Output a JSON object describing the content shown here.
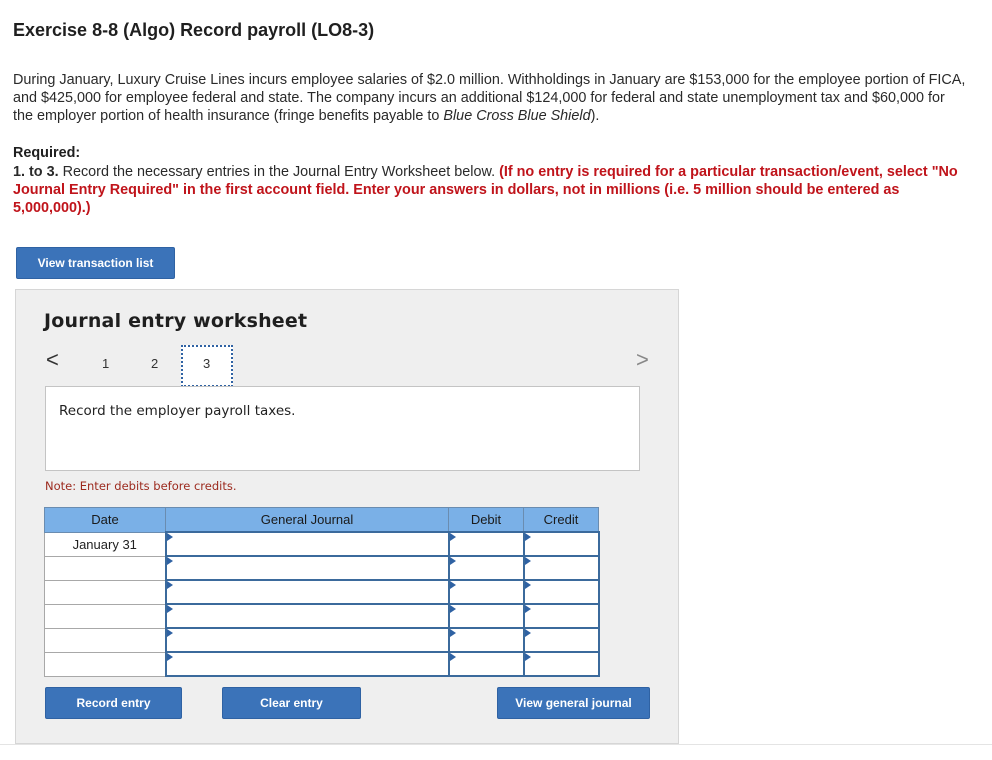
{
  "header": {
    "title": "Exercise 8-8 (Algo) Record payroll (LO8-3)"
  },
  "intro": {
    "text_before_italic": "During January, Luxury Cruise Lines incurs employee salaries of $2.0 million. Withholdings in January are $153,000 for the employee portion of FICA, and $425,000 for employee federal and state. The company incurs an additional $124,000 for federal and state unemployment tax and $60,000 for the employer portion of health insurance (fringe benefits payable to ",
    "italic": "Blue Cross Blue Shield",
    "text_after_italic": ")."
  },
  "required": {
    "heading": "Required:",
    "number": "1. to 3.",
    "text": " Record the necessary entries in the Journal Entry Worksheet below. ",
    "instruction": "(If no entry is required for a particular transaction/event, select \"No Journal Entry Required\" in the first account field. Enter your answers in dollars, not in millions (i.e. 5 million should be entered as 5,000,000).)"
  },
  "buttons": {
    "view_transaction_list": "View transaction list",
    "record_entry": "Record entry",
    "clear_entry": "Clear entry",
    "view_general_journal": "View general journal"
  },
  "worksheet": {
    "title": "Journal entry worksheet",
    "pages": [
      "1",
      "2",
      "3"
    ],
    "active_page": "3",
    "prev_arrow": "<",
    "next_arrow": ">",
    "description": "Record the employer payroll taxes.",
    "note": "Note: Enter debits before credits."
  },
  "journal_table": {
    "headers": [
      "Date",
      "General Journal",
      "Debit",
      "Credit"
    ],
    "rows": [
      {
        "date": "January 31"
      },
      {
        "date": ""
      },
      {
        "date": ""
      },
      {
        "date": ""
      },
      {
        "date": ""
      },
      {
        "date": ""
      }
    ]
  },
  "colors": {
    "primary_button": "#3b73b9",
    "table_header": "#7ab0e7",
    "instruction_red": "#c0141b",
    "note_text": "#9c2a1e"
  },
  "icons": {
    "prev": "chevron-left-icon",
    "next": "chevron-right-icon",
    "cell_marker": "triangle-marker-icon"
  }
}
